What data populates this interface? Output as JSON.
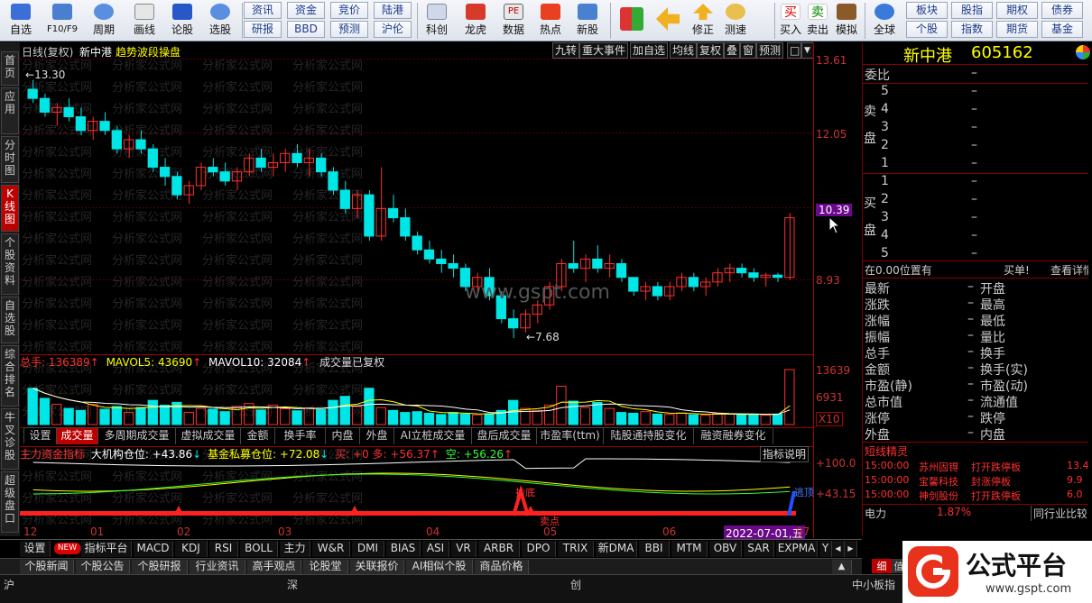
{
  "toolbar": {
    "items": [
      {
        "label": "自选",
        "icon": "star-icon"
      },
      {
        "label": "F10/F9",
        "icon": "f10-icon"
      },
      {
        "label": "周期",
        "icon": "clock-icon"
      },
      {
        "label": "画线",
        "icon": "pencil-icon"
      },
      {
        "label": "论股",
        "icon": "discuss-icon"
      },
      {
        "label": "选股",
        "icon": "select-stock-icon"
      }
    ],
    "small_buttons": [
      "资讯",
      "资金",
      "竞价",
      "陆港",
      "研报",
      "BBD",
      "预测",
      "沪伦"
    ],
    "items2": [
      {
        "label": "科创",
        "icon": "chart-icon"
      },
      {
        "label": "龙虎",
        "icon": "dragon-tiger-icon"
      },
      {
        "label": "数据",
        "icon": "pe-icon"
      },
      {
        "label": "热点",
        "icon": "hot-icon"
      },
      {
        "label": "新股",
        "icon": "new-stock-icon"
      }
    ],
    "items3": [
      {
        "label": "",
        "icon": "multi-window-icon"
      },
      {
        "label": "",
        "icon": "back-arrow-icon"
      },
      {
        "label": "修正",
        "icon": "up-arrow-icon"
      },
      {
        "label": "测速",
        "icon": "clock-speed-icon"
      },
      {
        "label": "买入",
        "icon": "buy-icon",
        "glyph": "买"
      },
      {
        "label": "卖出",
        "icon": "sell-icon",
        "glyph": "卖"
      },
      {
        "label": "模拟",
        "icon": "hammer-icon"
      },
      {
        "label": "全球",
        "icon": "globe-icon"
      }
    ],
    "right_buttons": [
      "板块",
      "股指",
      "期权",
      "债券",
      "个股",
      "指数",
      "期货",
      "基金"
    ]
  },
  "left_tabs": [
    "首页",
    "应用",
    "分时图",
    "K线图",
    "个股资料",
    "自选股",
    "综合排名",
    "牛叉诊股",
    "超级盘口"
  ],
  "chart_header": {
    "period": "日线(复权)",
    "stock_name": "新中港",
    "indicator_name": "趋势波段操盘",
    "buttons": [
      "九转",
      "重大事件",
      "加自选",
      "均线",
      "复权",
      "叠",
      "窗",
      "预测"
    ]
  },
  "main_chart": {
    "y_labels": [
      "13.61",
      "12.05",
      "10.39",
      "8.93"
    ],
    "highlight_price": "10.39",
    "high_marker": "13.30",
    "low_marker": "7.68",
    "watermark_site": "www.gspt.com",
    "watermark_text": "分析家公式网"
  },
  "volume": {
    "label_total": "总手: 136389",
    "label_ma5": "MAVOL5: 43690",
    "label_ma10": "MAVOL10: 32084",
    "note": "成交量已复权",
    "y_labels": [
      "13639",
      "6931",
      "X10"
    ]
  },
  "volume_tabs": [
    "设置",
    "成交量",
    "多周期成交量",
    "虚拟成交量",
    "金额",
    "换手率",
    "内盘",
    "外盘",
    "AI立桩成交量",
    "盘后成交量",
    "市盈率(ttm)",
    "陆股通持股变化",
    "融资融券变化"
  ],
  "indicator": {
    "name": "主力资金指标",
    "items": [
      {
        "label": "大机构仓位: +43.86",
        "color": "#ffffff"
      },
      {
        "label": "基金私募仓位: +72.08",
        "color": "#ffff00"
      },
      {
        "label": "买: +0 多: +56.37",
        "color": "#ff3030"
      },
      {
        "label": "空: +56.26",
        "color": "#30ff30"
      }
    ],
    "button": "指标说明",
    "y_labels": [
      "+100.0",
      "+43.15"
    ],
    "signals": [
      "抄底",
      "卖点",
      "逃顶"
    ]
  },
  "x_axis": {
    "labels": [
      "12",
      "01",
      "02",
      "03",
      "04",
      "05",
      "06",
      "07"
    ],
    "date_highlight": "2022-07-01,五"
  },
  "bottom_tabs": [
    "设置",
    "指标平台",
    "MACD",
    "KDJ",
    "RSI",
    "BOLL",
    "主力",
    "W&R",
    "DMI",
    "BIAS",
    "ASI",
    "VR",
    "ARBR",
    "DPO",
    "TRIX",
    "新DMA",
    "BBI",
    "MTM",
    "OBV",
    "SAR",
    "EXPMA",
    "Y"
  ],
  "new_badge": "NEW",
  "news_tabs": [
    "个股新闻",
    "个股公告",
    "个股研报",
    "行业资讯",
    "高手观点",
    "论股堂",
    "关联报价",
    "AI相似个股",
    "商品价格"
  ],
  "right_panel": {
    "stock_name": "新中港",
    "stock_code": "605162",
    "weibi": "委比",
    "weibi_val": "–",
    "sell_label": "卖盘",
    "buy_label": "买盘",
    "sell_levels": [
      "5",
      "4",
      "3",
      "2",
      "1"
    ],
    "buy_levels": [
      "1",
      "2",
      "3",
      "4",
      "5"
    ],
    "dash": "–",
    "position_note": "在0.00位置有",
    "buy_single": "买单!",
    "view_detail": "查看详情",
    "stats_left": [
      "最新",
      "涨跌",
      "涨幅",
      "振幅",
      "总手",
      "金额",
      "市盈(静)",
      "总市值",
      "涨停",
      "外盘"
    ],
    "stats_right": [
      "开盘",
      "最高",
      "最低",
      "量比",
      "换手",
      "换手(实)",
      "市盈(动)",
      "流通值",
      "跌停",
      "内盘"
    ],
    "jingling_title": "短线精灵",
    "jingling": [
      {
        "time": "15:00:00",
        "name": "苏州固锝",
        "event": "打开跌停板",
        "val": "13.4"
      },
      {
        "time": "15:00:00",
        "name": "宝馨科技",
        "event": "封涨停板",
        "val": "9.9"
      },
      {
        "time": "15:00:00",
        "name": "神剑股份",
        "event": "打开跌停板",
        "val": "6.0"
      }
    ],
    "sector": "电力",
    "sector_pct": "1.87%",
    "compare": "同行业比较",
    "tabs": [
      "细",
      "值"
    ]
  },
  "status": {
    "sh": "沪",
    "sz": "深",
    "cy": "创",
    "zx": "中小板指"
  },
  "brand": {
    "name": "公式平台",
    "url": "www.gspt.com"
  },
  "colors": {
    "up": "#ff3030",
    "down": "#00e5e5",
    "accent_red": "#b00000"
  },
  "chart_data": {
    "type": "candlestick",
    "price_ylim": [
      7.68,
      13.61
    ],
    "ohlc_sketch": [
      [
        13.1,
        13.3,
        12.8,
        12.9
      ],
      [
        12.9,
        13.0,
        12.5,
        12.6
      ],
      [
        12.6,
        12.8,
        12.3,
        12.7
      ],
      [
        12.7,
        12.9,
        12.4,
        12.5
      ],
      [
        12.5,
        12.7,
        12.1,
        12.2
      ],
      [
        12.2,
        12.5,
        12.0,
        12.4
      ],
      [
        12.4,
        12.6,
        12.1,
        12.2
      ],
      [
        12.2,
        12.3,
        11.7,
        11.8
      ],
      [
        11.8,
        12.1,
        11.6,
        12.0
      ],
      [
        12.0,
        12.2,
        11.7,
        11.8
      ],
      [
        11.8,
        11.9,
        11.3,
        11.4
      ],
      [
        11.4,
        11.6,
        11.0,
        11.2
      ],
      [
        11.2,
        11.3,
        10.7,
        10.8
      ],
      [
        10.8,
        11.1,
        10.6,
        11.0
      ],
      [
        11.0,
        11.5,
        10.9,
        11.4
      ],
      [
        11.4,
        11.6,
        11.2,
        11.3
      ],
      [
        11.3,
        11.5,
        11.0,
        11.1
      ],
      [
        11.1,
        11.4,
        10.9,
        11.3
      ],
      [
        11.3,
        11.7,
        11.2,
        11.6
      ],
      [
        11.6,
        11.8,
        11.3,
        11.4
      ],
      [
        11.4,
        11.7,
        11.2,
        11.5
      ],
      [
        11.5,
        11.8,
        11.3,
        11.7
      ],
      [
        11.7,
        11.9,
        11.4,
        11.5
      ],
      [
        11.5,
        11.8,
        11.2,
        11.6
      ],
      [
        11.6,
        11.7,
        11.2,
        11.3
      ],
      [
        11.3,
        11.4,
        10.8,
        10.9
      ],
      [
        10.9,
        11.1,
        10.4,
        10.5
      ],
      [
        10.5,
        10.9,
        10.3,
        10.8
      ],
      [
        10.8,
        10.9,
        9.8,
        9.9
      ],
      [
        9.9,
        11.4,
        9.8,
        10.5
      ],
      [
        10.5,
        10.8,
        10.2,
        10.3
      ],
      [
        10.3,
        10.5,
        9.8,
        9.9
      ],
      [
        9.9,
        10.0,
        9.5,
        9.6
      ],
      [
        9.6,
        9.8,
        9.3,
        9.4
      ],
      [
        9.4,
        9.6,
        9.1,
        9.3
      ],
      [
        9.3,
        9.5,
        9.0,
        9.2
      ],
      [
        9.2,
        9.3,
        8.7,
        8.8
      ],
      [
        8.8,
        9.1,
        8.6,
        9.0
      ],
      [
        9.0,
        9.2,
        8.5,
        8.6
      ],
      [
        8.6,
        8.7,
        8.0,
        8.1
      ],
      [
        8.1,
        8.3,
        7.68,
        7.9
      ],
      [
        7.9,
        8.3,
        7.8,
        8.2
      ],
      [
        8.2,
        8.5,
        8.0,
        8.4
      ],
      [
        8.4,
        8.9,
        8.3,
        8.8
      ],
      [
        8.8,
        9.4,
        8.7,
        9.3
      ],
      [
        9.3,
        9.8,
        9.1,
        9.2
      ],
      [
        9.2,
        9.5,
        8.9,
        9.4
      ],
      [
        9.4,
        9.7,
        9.1,
        9.2
      ],
      [
        9.2,
        9.5,
        9.0,
        9.3
      ],
      [
        9.3,
        9.4,
        8.9,
        9.0
      ],
      [
        9.0,
        9.0,
        8.6,
        8.7
      ],
      [
        8.7,
        8.9,
        8.5,
        8.8
      ],
      [
        8.8,
        8.9,
        8.5,
        8.6
      ],
      [
        8.6,
        8.9,
        8.5,
        8.8
      ],
      [
        8.8,
        9.1,
        8.7,
        9.0
      ],
      [
        9.0,
        9.1,
        8.7,
        8.8
      ],
      [
        8.8,
        9.0,
        8.6,
        8.9
      ],
      [
        8.9,
        9.2,
        8.8,
        9.1
      ],
      [
        9.1,
        9.3,
        8.9,
        9.2
      ],
      [
        9.2,
        9.3,
        9.0,
        9.1
      ],
      [
        9.1,
        9.2,
        8.9,
        9.0
      ],
      [
        9.0,
        9.1,
        8.8,
        9.05
      ],
      [
        9.05,
        9.1,
        8.9,
        9.0
      ],
      [
        9.0,
        10.4,
        8.95,
        10.3
      ]
    ],
    "volume": [
      9000,
      6500,
      5000,
      4000,
      3500,
      5000,
      3800,
      4500,
      3000,
      4200,
      6000,
      4800,
      5500,
      3000,
      4000,
      3800,
      3200,
      4500,
      5200,
      3600,
      4800,
      3900,
      3400,
      4100,
      3700,
      6000,
      7000,
      4500,
      9000,
      4200,
      3500,
      3000,
      3200,
      2800,
      2500,
      3000,
      2600,
      2400,
      2700,
      3500,
      6000,
      4000,
      3500,
      4800,
      9500,
      5800,
      4200,
      5500,
      4000,
      3000,
      2800,
      3200,
      2600,
      2500,
      2900,
      2400,
      2300,
      2800,
      2600,
      2500,
      2400,
      2300,
      2600,
      13639
    ],
    "ylabel": "",
    "xlabel": ""
  }
}
